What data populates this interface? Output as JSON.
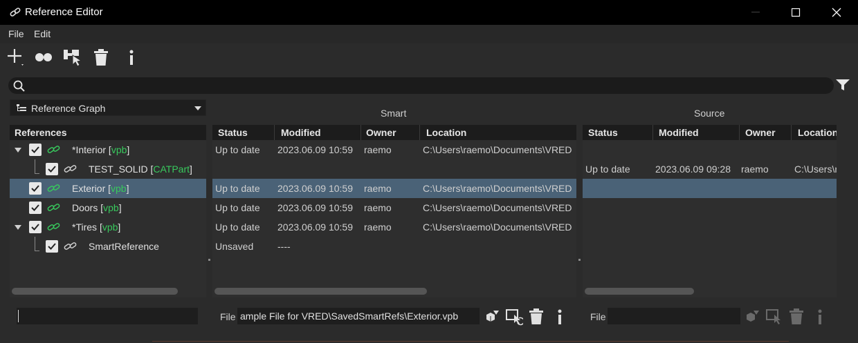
{
  "window": {
    "title": "Reference Editor",
    "icon": "link-icon"
  },
  "menu": [
    "File",
    "Edit"
  ],
  "toolbar": [
    {
      "name": "add-reference-button",
      "icon": "plus-icon"
    },
    {
      "name": "variant-button",
      "icon": "two-dots-icon"
    },
    {
      "name": "select-node-button",
      "icon": "pick-cursor-icon"
    },
    {
      "name": "delete-button",
      "icon": "trash-icon"
    },
    {
      "name": "info-button",
      "icon": "info-icon"
    }
  ],
  "search": {
    "placeholder": "",
    "value": ""
  },
  "view_select": {
    "value": "Reference Graph"
  },
  "captions": {
    "smart": "Smart",
    "source": "Source"
  },
  "references": {
    "header": "References",
    "items": [
      {
        "prefix": "*Interior ",
        "ext": "vpb",
        "level": 0,
        "expanded": true,
        "checked": true
      },
      {
        "prefix": "TEST_SOLID ",
        "ext": "CATPart",
        "level": 1,
        "checked": true
      },
      {
        "prefix": "Exterior ",
        "ext": "vpb",
        "level": 0,
        "checked": true,
        "selected": true
      },
      {
        "prefix": "Doors ",
        "ext": "vpb",
        "level": 0,
        "checked": true
      },
      {
        "prefix": "*Tires ",
        "ext": "vpb",
        "level": 0,
        "expanded": true,
        "checked": true
      },
      {
        "prefix": "SmartReference",
        "ext": "",
        "level": 1,
        "checked": true
      }
    ]
  },
  "smart": {
    "headers": [
      "Status",
      "Modified",
      "Owner",
      "Location"
    ],
    "rows": [
      [
        "Up to date",
        "2023.06.09 10:59",
        "raemo",
        "C:\\Users\\raemo\\Documents\\VRED"
      ],
      [
        "",
        "",
        "",
        ""
      ],
      [
        "Up to date",
        "2023.06.09 10:59",
        "raemo",
        "C:\\Users\\raemo\\Documents\\VRED"
      ],
      [
        "Up to date",
        "2023.06.09 10:59",
        "raemo",
        "C:\\Users\\raemo\\Documents\\VRED"
      ],
      [
        "Up to date",
        "2023.06.09 10:59",
        "raemo",
        "C:\\Users\\raemo\\Documents\\VRED"
      ],
      [
        "Unsaved",
        "----",
        "",
        ""
      ]
    ]
  },
  "source": {
    "headers": [
      "Status",
      "Modified",
      "Owner",
      "Location"
    ],
    "rows": [
      [
        "",
        "",
        "",
        ""
      ],
      [
        "Up to date",
        "2023.06.09 09:28",
        "raemo",
        "C:\\Users\\r"
      ],
      [
        "",
        "",
        "",
        ""
      ],
      [
        "",
        "",
        "",
        ""
      ],
      [
        "",
        "",
        "",
        ""
      ],
      [
        "",
        "",
        "",
        ""
      ]
    ]
  },
  "bottom": {
    "file_label": "File",
    "smart_file_value": "ample File for VRED\\SavedSmartRefs\\Exterior.vpb",
    "source_file_label": "File",
    "source_file_value": ""
  },
  "colors": {
    "accent_green": "#38c95d",
    "selection": "#4a6277"
  }
}
